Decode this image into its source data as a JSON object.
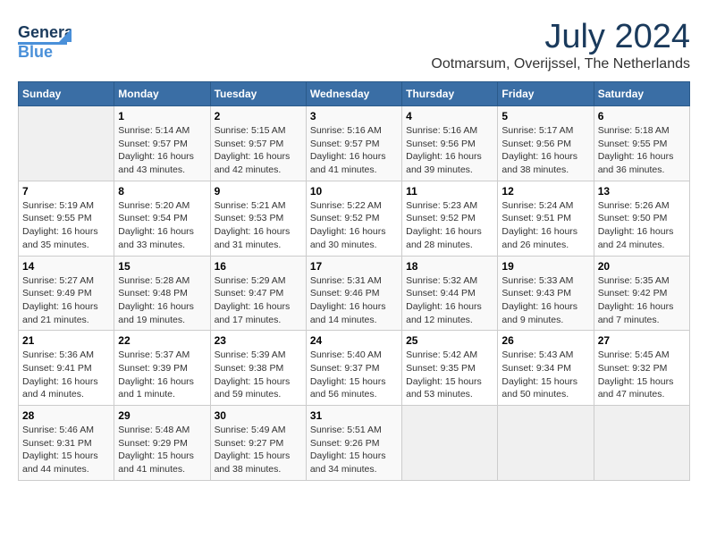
{
  "header": {
    "logo_line1": "General",
    "logo_line2": "Blue",
    "month_year": "July 2024",
    "location": "Ootmarsum, Overijssel, The Netherlands"
  },
  "columns": [
    "Sunday",
    "Monday",
    "Tuesday",
    "Wednesday",
    "Thursday",
    "Friday",
    "Saturday"
  ],
  "weeks": [
    [
      {
        "day": "",
        "sunrise": "",
        "sunset": "",
        "daylight": ""
      },
      {
        "day": "1",
        "sunrise": "Sunrise: 5:14 AM",
        "sunset": "Sunset: 9:57 PM",
        "daylight": "Daylight: 16 hours and 43 minutes."
      },
      {
        "day": "2",
        "sunrise": "Sunrise: 5:15 AM",
        "sunset": "Sunset: 9:57 PM",
        "daylight": "Daylight: 16 hours and 42 minutes."
      },
      {
        "day": "3",
        "sunrise": "Sunrise: 5:16 AM",
        "sunset": "Sunset: 9:57 PM",
        "daylight": "Daylight: 16 hours and 41 minutes."
      },
      {
        "day": "4",
        "sunrise": "Sunrise: 5:16 AM",
        "sunset": "Sunset: 9:56 PM",
        "daylight": "Daylight: 16 hours and 39 minutes."
      },
      {
        "day": "5",
        "sunrise": "Sunrise: 5:17 AM",
        "sunset": "Sunset: 9:56 PM",
        "daylight": "Daylight: 16 hours and 38 minutes."
      },
      {
        "day": "6",
        "sunrise": "Sunrise: 5:18 AM",
        "sunset": "Sunset: 9:55 PM",
        "daylight": "Daylight: 16 hours and 36 minutes."
      }
    ],
    [
      {
        "day": "7",
        "sunrise": "Sunrise: 5:19 AM",
        "sunset": "Sunset: 9:55 PM",
        "daylight": "Daylight: 16 hours and 35 minutes."
      },
      {
        "day": "8",
        "sunrise": "Sunrise: 5:20 AM",
        "sunset": "Sunset: 9:54 PM",
        "daylight": "Daylight: 16 hours and 33 minutes."
      },
      {
        "day": "9",
        "sunrise": "Sunrise: 5:21 AM",
        "sunset": "Sunset: 9:53 PM",
        "daylight": "Daylight: 16 hours and 31 minutes."
      },
      {
        "day": "10",
        "sunrise": "Sunrise: 5:22 AM",
        "sunset": "Sunset: 9:52 PM",
        "daylight": "Daylight: 16 hours and 30 minutes."
      },
      {
        "day": "11",
        "sunrise": "Sunrise: 5:23 AM",
        "sunset": "Sunset: 9:52 PM",
        "daylight": "Daylight: 16 hours and 28 minutes."
      },
      {
        "day": "12",
        "sunrise": "Sunrise: 5:24 AM",
        "sunset": "Sunset: 9:51 PM",
        "daylight": "Daylight: 16 hours and 26 minutes."
      },
      {
        "day": "13",
        "sunrise": "Sunrise: 5:26 AM",
        "sunset": "Sunset: 9:50 PM",
        "daylight": "Daylight: 16 hours and 24 minutes."
      }
    ],
    [
      {
        "day": "14",
        "sunrise": "Sunrise: 5:27 AM",
        "sunset": "Sunset: 9:49 PM",
        "daylight": "Daylight: 16 hours and 21 minutes."
      },
      {
        "day": "15",
        "sunrise": "Sunrise: 5:28 AM",
        "sunset": "Sunset: 9:48 PM",
        "daylight": "Daylight: 16 hours and 19 minutes."
      },
      {
        "day": "16",
        "sunrise": "Sunrise: 5:29 AM",
        "sunset": "Sunset: 9:47 PM",
        "daylight": "Daylight: 16 hours and 17 minutes."
      },
      {
        "day": "17",
        "sunrise": "Sunrise: 5:31 AM",
        "sunset": "Sunset: 9:46 PM",
        "daylight": "Daylight: 16 hours and 14 minutes."
      },
      {
        "day": "18",
        "sunrise": "Sunrise: 5:32 AM",
        "sunset": "Sunset: 9:44 PM",
        "daylight": "Daylight: 16 hours and 12 minutes."
      },
      {
        "day": "19",
        "sunrise": "Sunrise: 5:33 AM",
        "sunset": "Sunset: 9:43 PM",
        "daylight": "Daylight: 16 hours and 9 minutes."
      },
      {
        "day": "20",
        "sunrise": "Sunrise: 5:35 AM",
        "sunset": "Sunset: 9:42 PM",
        "daylight": "Daylight: 16 hours and 7 minutes."
      }
    ],
    [
      {
        "day": "21",
        "sunrise": "Sunrise: 5:36 AM",
        "sunset": "Sunset: 9:41 PM",
        "daylight": "Daylight: 16 hours and 4 minutes."
      },
      {
        "day": "22",
        "sunrise": "Sunrise: 5:37 AM",
        "sunset": "Sunset: 9:39 PM",
        "daylight": "Daylight: 16 hours and 1 minute."
      },
      {
        "day": "23",
        "sunrise": "Sunrise: 5:39 AM",
        "sunset": "Sunset: 9:38 PM",
        "daylight": "Daylight: 15 hours and 59 minutes."
      },
      {
        "day": "24",
        "sunrise": "Sunrise: 5:40 AM",
        "sunset": "Sunset: 9:37 PM",
        "daylight": "Daylight: 15 hours and 56 minutes."
      },
      {
        "day": "25",
        "sunrise": "Sunrise: 5:42 AM",
        "sunset": "Sunset: 9:35 PM",
        "daylight": "Daylight: 15 hours and 53 minutes."
      },
      {
        "day": "26",
        "sunrise": "Sunrise: 5:43 AM",
        "sunset": "Sunset: 9:34 PM",
        "daylight": "Daylight: 15 hours and 50 minutes."
      },
      {
        "day": "27",
        "sunrise": "Sunrise: 5:45 AM",
        "sunset": "Sunset: 9:32 PM",
        "daylight": "Daylight: 15 hours and 47 minutes."
      }
    ],
    [
      {
        "day": "28",
        "sunrise": "Sunrise: 5:46 AM",
        "sunset": "Sunset: 9:31 PM",
        "daylight": "Daylight: 15 hours and 44 minutes."
      },
      {
        "day": "29",
        "sunrise": "Sunrise: 5:48 AM",
        "sunset": "Sunset: 9:29 PM",
        "daylight": "Daylight: 15 hours and 41 minutes."
      },
      {
        "day": "30",
        "sunrise": "Sunrise: 5:49 AM",
        "sunset": "Sunset: 9:27 PM",
        "daylight": "Daylight: 15 hours and 38 minutes."
      },
      {
        "day": "31",
        "sunrise": "Sunrise: 5:51 AM",
        "sunset": "Sunset: 9:26 PM",
        "daylight": "Daylight: 15 hours and 34 minutes."
      },
      {
        "day": "",
        "sunrise": "",
        "sunset": "",
        "daylight": ""
      },
      {
        "day": "",
        "sunrise": "",
        "sunset": "",
        "daylight": ""
      },
      {
        "day": "",
        "sunrise": "",
        "sunset": "",
        "daylight": ""
      }
    ]
  ]
}
